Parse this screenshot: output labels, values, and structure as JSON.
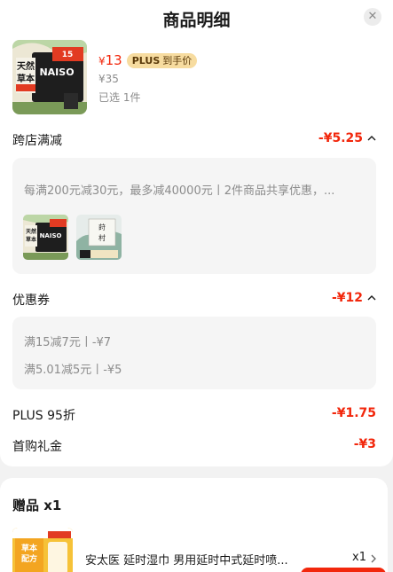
{
  "header": {
    "title": "商品明细",
    "close_icon": "close-icon"
  },
  "product": {
    "thumb_logo": "NAISO",
    "thumb_tag": "天然草本",
    "price_symbol": "¥",
    "price": "13",
    "plus_badge_brand": "PLUS",
    "plus_badge_text": "到手价",
    "original_price": "¥35",
    "selected_text": "已选 1件"
  },
  "cross_store": {
    "label": "跨店满减",
    "value": "-¥5.25",
    "description": "每满200元减30元，最多减40000元丨2件商品共享优惠，..."
  },
  "coupon": {
    "label": "优惠券",
    "value": "-¥12",
    "items": [
      "满15减7元丨-¥7",
      "满5.01减5元丨-¥5"
    ]
  },
  "plus_discount": {
    "label": "PLUS 95折",
    "value": "-¥1.75"
  },
  "first_gift": {
    "label": "首购礼金",
    "value": "-¥3"
  },
  "gift": {
    "title": "赠品 x1",
    "name": "安太医 延时湿巾 男用延时中式延时喷...",
    "qty": "x1"
  },
  "colors": {
    "accent": "#f2270c",
    "plus_badge_bg": "#f7dca0",
    "panel_bg": "#f5f5f5"
  }
}
